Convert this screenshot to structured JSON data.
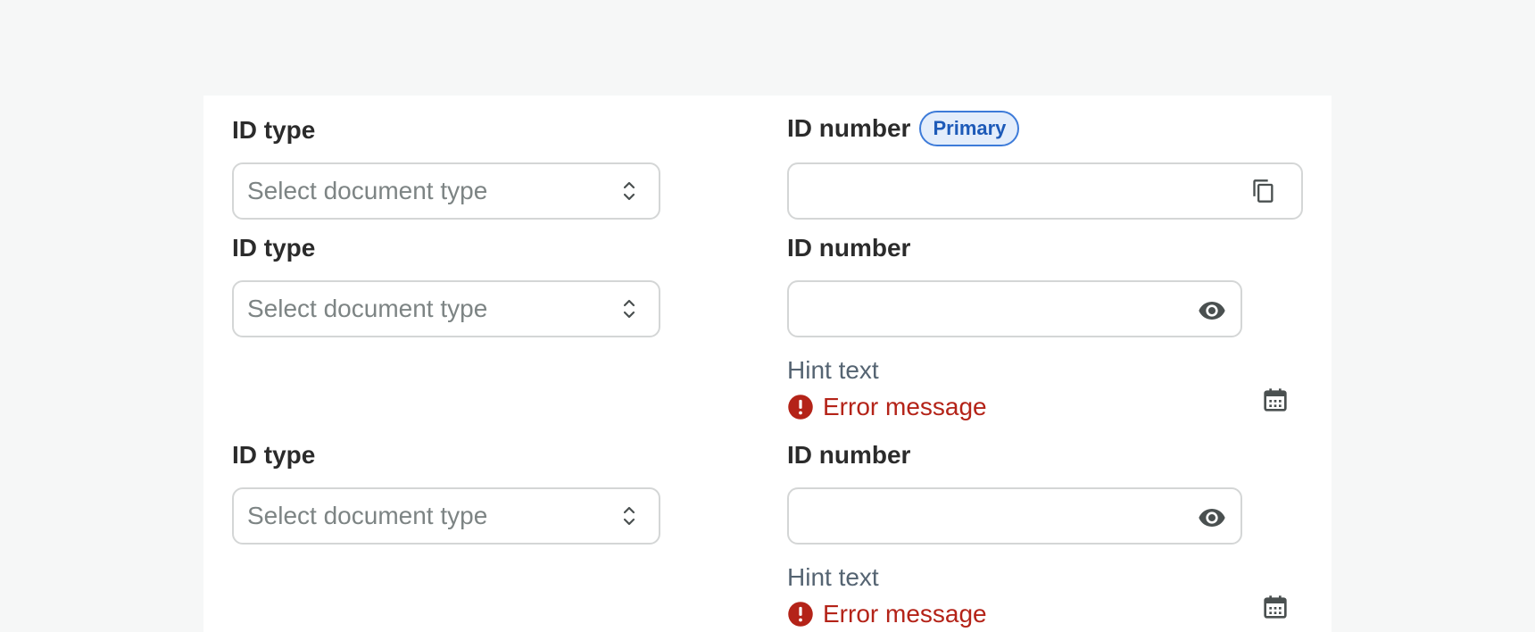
{
  "rows": [
    {
      "id_type_label": "ID type",
      "select_placeholder": "Select document type",
      "id_number_label": "ID number",
      "badge": "Primary"
    },
    {
      "id_type_label": "ID type",
      "select_placeholder": "Select document type",
      "id_number_label": "ID number",
      "hint": "Hint text",
      "error": "Error message"
    },
    {
      "id_type_label": "ID type",
      "select_placeholder": "Select document type",
      "id_number_label": "ID number",
      "hint": "Hint text",
      "error": "Error message"
    }
  ],
  "icons": {
    "row1_action": "copy-icon",
    "row2_action": "eye-icon",
    "row2_extra": "calendar-icon",
    "row3_action": "eye-icon",
    "row3_extra": "calendar-icon",
    "error": "alert-circle-icon",
    "select": "chevron-up-down-icon"
  },
  "colors": {
    "error": "#b42318",
    "badge_border": "#3d7bd9",
    "badge_bg": "#e3edfb",
    "badge_text": "#1d5ab8"
  }
}
